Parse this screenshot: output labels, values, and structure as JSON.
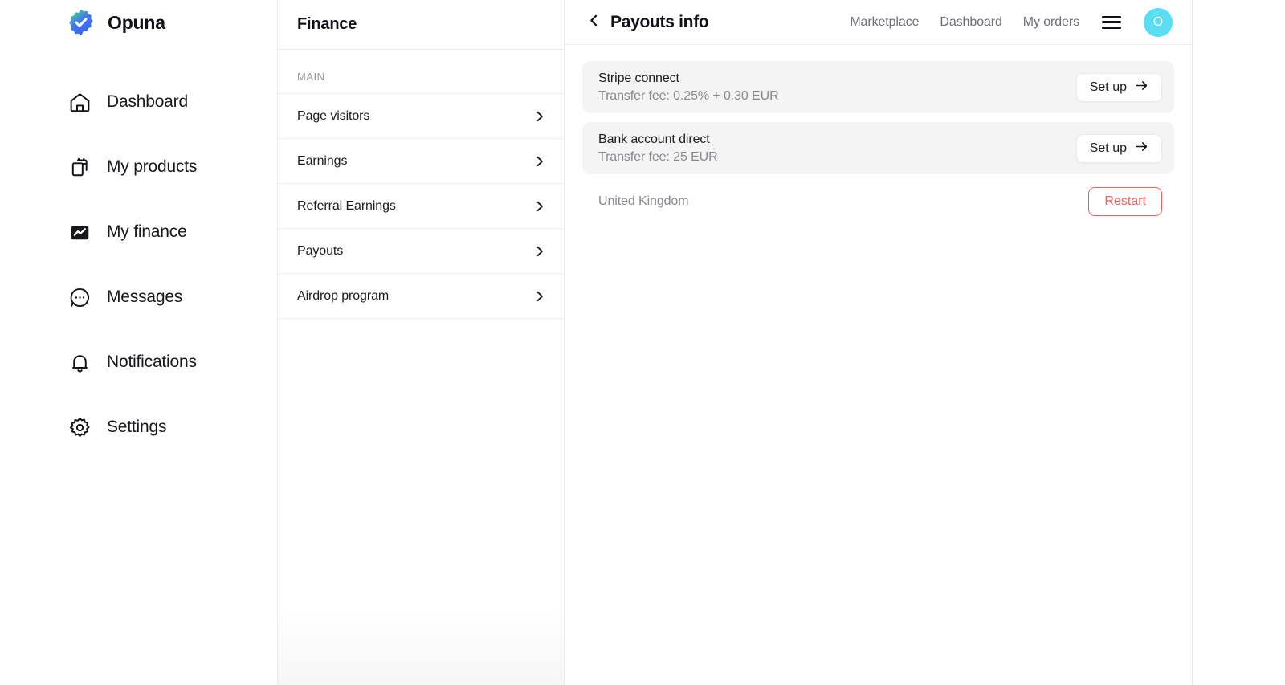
{
  "brand": {
    "name": "Opuna",
    "logo_icon": "verified-badge-icon",
    "logo_gradient_from": "#4ADE80",
    "logo_gradient_to": "#3B5BF5"
  },
  "sidebar": {
    "items": [
      {
        "label": "Dashboard",
        "icon": "home-icon",
        "active": false
      },
      {
        "label": "My products",
        "icon": "clipboard-icon",
        "active": false
      },
      {
        "label": "My finance",
        "icon": "chart-line-icon",
        "active": true
      },
      {
        "label": "Messages",
        "icon": "chat-bubble-icon",
        "active": false
      },
      {
        "label": "Notifications",
        "icon": "bell-icon",
        "active": false
      },
      {
        "label": "Settings",
        "icon": "gear-icon",
        "active": false
      }
    ]
  },
  "finance_panel": {
    "title": "Finance",
    "section_label": "MAIN",
    "items": [
      {
        "label": "Page visitors",
        "chevron": "chevron-right-icon"
      },
      {
        "label": "Earnings",
        "chevron": "chevron-right-icon"
      },
      {
        "label": "Referral Earnings",
        "chevron": "chevron-right-icon"
      },
      {
        "label": "Payouts",
        "chevron": "chevron-right-icon"
      },
      {
        "label": "Airdrop program",
        "chevron": "chevron-right-icon"
      }
    ]
  },
  "header": {
    "back_icon": "chevron-left-icon",
    "title": "Payouts info",
    "nav_links": [
      {
        "label": "Marketplace"
      },
      {
        "label": "Dashboard"
      },
      {
        "label": "My orders"
      }
    ],
    "menu_icon": "hamburger-menu-icon",
    "avatar": {
      "initial": "O",
      "color": "#5BDDF2"
    }
  },
  "payouts": {
    "methods": [
      {
        "title": "Stripe connect",
        "subtitle": "Transfer fee: 0.25% + 0.30 EUR",
        "action_label": "Set up",
        "action_icon": "arrow-right-icon"
      },
      {
        "title": "Bank account direct",
        "subtitle": "Transfer fee: 25 EUR",
        "action_label": "Set up",
        "action_icon": "arrow-right-icon"
      }
    ],
    "country": "United Kingdom",
    "restart_label": "Restart",
    "restart_color": "#FC5B5B"
  }
}
